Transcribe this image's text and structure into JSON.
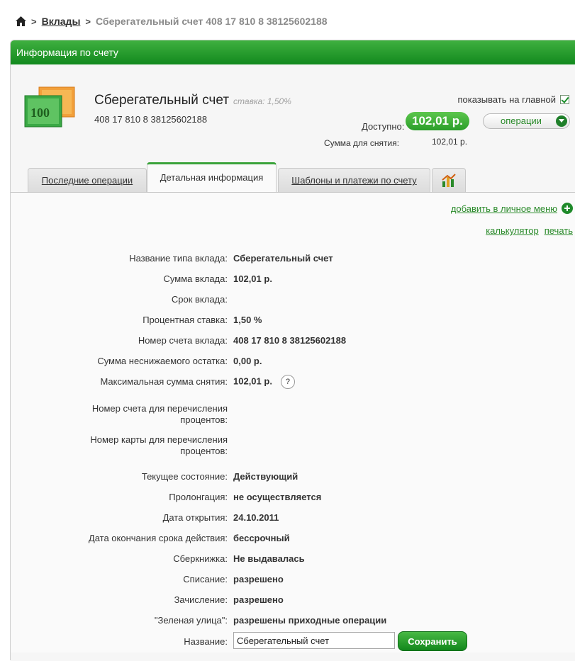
{
  "breadcrumb": {
    "separator": ">",
    "link": "Вклады",
    "current": "Сберегательный счет 408 17 810 8 38125602188"
  },
  "panel": {
    "title": "Информация по счету"
  },
  "account": {
    "name": "Сберегательный счет",
    "rate_label": "ставка: 1,50%",
    "number": "408 17 810 8 38125602188",
    "show_on_main_label": "показывать на главной",
    "available_label": "Доступно:",
    "available_value": "102,01 р.",
    "operations_label": "операции",
    "withdraw_label": "Сумма для снятия:",
    "withdraw_value": "102,01 р."
  },
  "tabs": [
    {
      "label": "Последние операции"
    },
    {
      "label": "Детальная информация"
    },
    {
      "label": "Шаблоны и платежи по счету"
    }
  ],
  "links": {
    "add_menu": "добавить в личное меню",
    "calculator": "калькулятор",
    "print": "печать"
  },
  "details": [
    {
      "label": "Название типа вклада:",
      "value": "Сберегательный счет"
    },
    {
      "label": "Сумма вклада:",
      "value": "102,01 р."
    },
    {
      "label": "Срок вклада:",
      "value": ""
    },
    {
      "label": "Процентная ставка:",
      "value": "1,50 %"
    },
    {
      "label": "Номер счета вклада:",
      "value": "408 17 810 8 38125602188"
    },
    {
      "label": "Сумма неснижаемого остатка:",
      "value": "0,00 р."
    },
    {
      "label": "Максимальная сумма снятия:",
      "value": "102,01 р."
    },
    {
      "label": "Номер счета для перечисления процентов:",
      "value": ""
    },
    {
      "label": "Номер карты для перечисления процентов:",
      "value": ""
    },
    {
      "label": "Текущее состояние:",
      "value": "Действующий"
    },
    {
      "label": "Пролонгация:",
      "value": "не осуществляется"
    },
    {
      "label": "Дата открытия:",
      "value": "24.10.2011"
    },
    {
      "label": "Дата окончания срока действия:",
      "value": "бессрочный"
    },
    {
      "label": "Сберкнижка:",
      "value": "Не выдавалась"
    },
    {
      "label": "Списание:",
      "value": "разрешено"
    },
    {
      "label": "Зачисление:",
      "value": "разрешено"
    },
    {
      "label": "\"Зеленая улица\":",
      "value": "разрешены приходные операции"
    }
  ],
  "help_mark": "?",
  "name_field": {
    "label": "Название:",
    "value": "Сберегательный счет",
    "save_label": "Сохранить"
  }
}
